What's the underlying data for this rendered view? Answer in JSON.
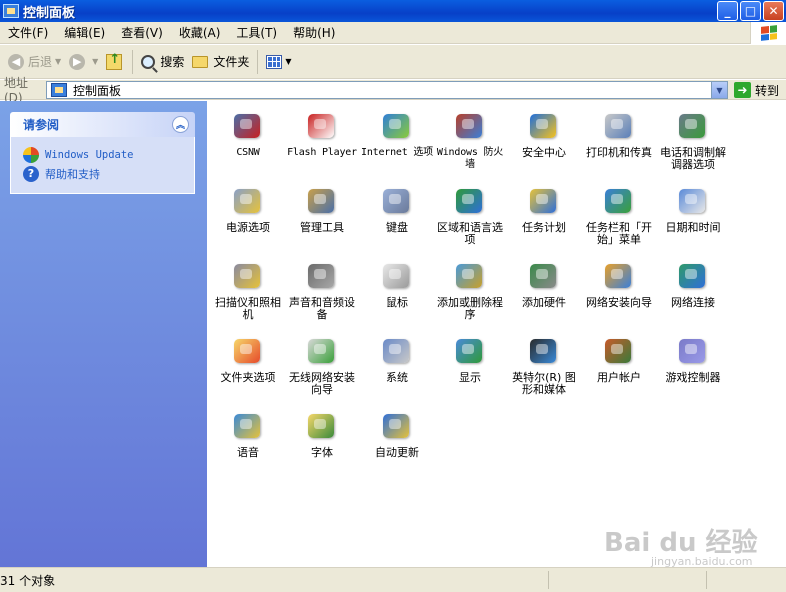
{
  "window": {
    "title": "控制面板"
  },
  "title_buttons": {
    "minimize": "_",
    "maximize": "□",
    "close": "✕"
  },
  "menu": [
    "文件(F)",
    "编辑(E)",
    "查看(V)",
    "收藏(A)",
    "工具(T)",
    "帮助(H)"
  ],
  "toolbar": {
    "back": "后退",
    "forward": "",
    "search": "搜索",
    "folders": "文件夹"
  },
  "address": {
    "label": "地址(D)",
    "value": "控制面板",
    "go": "转到"
  },
  "see_also": {
    "title": "请参阅",
    "links": [
      {
        "label": "Windows Update",
        "icon": "windows-update-icon"
      },
      {
        "label": "帮助和支持",
        "icon": "help-icon"
      }
    ]
  },
  "items": [
    {
      "label": "CSNW",
      "icon": "network-client-icon",
      "mono": true
    },
    {
      "label": "Flash Player",
      "icon": "flash-player-icon",
      "mono": true
    },
    {
      "label": "Internet 选项",
      "icon": "internet-options-icon",
      "mono": true
    },
    {
      "label": "Windows 防火墙",
      "icon": "firewall-icon",
      "mono": true
    },
    {
      "label": "安全中心",
      "icon": "security-center-icon"
    },
    {
      "label": "打印机和传真",
      "icon": "printer-icon"
    },
    {
      "label": "电话和调制解调器选项",
      "icon": "phone-modem-icon"
    },
    {
      "label": "电源选项",
      "icon": "power-options-icon"
    },
    {
      "label": "管理工具",
      "icon": "admin-tools-icon"
    },
    {
      "label": "键盘",
      "icon": "keyboard-icon"
    },
    {
      "label": "区域和语言选项",
      "icon": "globe-icon"
    },
    {
      "label": "任务计划",
      "icon": "scheduled-tasks-icon"
    },
    {
      "label": "任务栏和「开始」菜单",
      "icon": "taskbar-icon"
    },
    {
      "label": "日期和时间",
      "icon": "clock-icon"
    },
    {
      "label": "扫描仪和照相机",
      "icon": "scanner-camera-icon"
    },
    {
      "label": "声音和音频设备",
      "icon": "speaker-icon"
    },
    {
      "label": "鼠标",
      "icon": "mouse-icon"
    },
    {
      "label": "添加或删除程序",
      "icon": "add-remove-programs-icon"
    },
    {
      "label": "添加硬件",
      "icon": "add-hardware-icon"
    },
    {
      "label": "网络安装向导",
      "icon": "network-wizard-icon"
    },
    {
      "label": "网络连接",
      "icon": "network-connections-icon"
    },
    {
      "label": "文件夹选项",
      "icon": "folder-options-icon"
    },
    {
      "label": "无线网络安装向导",
      "icon": "wireless-wizard-icon"
    },
    {
      "label": "系统",
      "icon": "system-icon"
    },
    {
      "label": "显示",
      "icon": "display-icon"
    },
    {
      "label": "英特尔(R) 图形和媒体",
      "icon": "intel-graphics-icon"
    },
    {
      "label": "用户帐户",
      "icon": "user-accounts-icon"
    },
    {
      "label": "游戏控制器",
      "icon": "game-controller-icon"
    },
    {
      "label": "语音",
      "icon": "speech-icon"
    },
    {
      "label": "字体",
      "icon": "fonts-icon"
    },
    {
      "label": "自动更新",
      "icon": "automatic-updates-icon"
    }
  ],
  "status": {
    "text": "31 个对象"
  },
  "watermark": {
    "main": "Bai du 经验",
    "sub": "jingyan.baidu.com"
  }
}
